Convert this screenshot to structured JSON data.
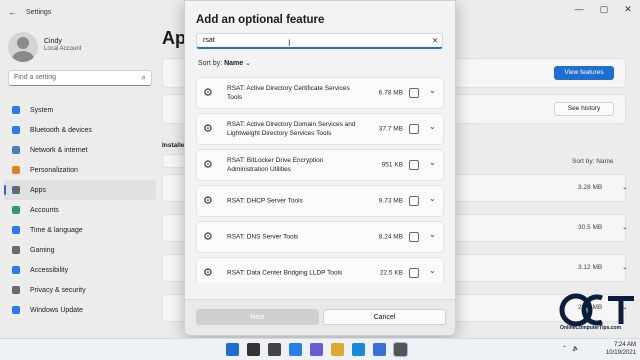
{
  "settings": {
    "title": "Settings",
    "user": {
      "name": "Cindy",
      "account": "Local Account"
    },
    "search_placeholder": "Find a setting",
    "nav": [
      {
        "label": "System",
        "icon": "monitor-icon",
        "color": "#2b7de9"
      },
      {
        "label": "Bluetooth & devices",
        "icon": "bluetooth-icon",
        "color": "#2b7de9"
      },
      {
        "label": "Network & internet",
        "icon": "wifi-icon",
        "color": "#4a7fb5"
      },
      {
        "label": "Personalization",
        "icon": "brush-icon",
        "color": "#d9822b"
      },
      {
        "label": "Apps",
        "icon": "apps-icon",
        "color": "#5b6b7a"
      },
      {
        "label": "Accounts",
        "icon": "person-icon",
        "color": "#2f9b6b"
      },
      {
        "label": "Time & language",
        "icon": "globe-clock-icon",
        "color": "#2b7de9"
      },
      {
        "label": "Gaming",
        "icon": "controller-icon",
        "color": "#6b6b6b"
      },
      {
        "label": "Accessibility",
        "icon": "accessibility-icon",
        "color": "#2b7de9"
      },
      {
        "label": "Privacy & security",
        "icon": "shield-icon",
        "color": "#6b6b6b"
      },
      {
        "label": "Windows Update",
        "icon": "update-icon",
        "color": "#2b7de9"
      }
    ],
    "active_nav": "Apps",
    "page_title": "App",
    "view_features_label": "View features",
    "see_history_label": "See history",
    "installed_label": "Installe",
    "sort_label": "Sort by: Name",
    "installed_sizes": [
      "3.28 MB",
      "30.5 MB",
      "3.12 MB",
      "25.8 MB"
    ]
  },
  "dialog": {
    "title": "Add an optional feature",
    "search_value": "rsat",
    "sort_label": "Sort by:",
    "sort_value": "Name",
    "features": [
      {
        "name": "RSAT: Active Directory Certificate Services Tools",
        "size": "6.78 MB"
      },
      {
        "name": "RSAT: Active Directory Domain Services and Lightweight Directory Services Tools",
        "size": "37.7 MB"
      },
      {
        "name": "RSAT: BitLocker Drive Encryption Administration Utilities",
        "size": "951 KB"
      },
      {
        "name": "RSAT: DHCP Server Tools",
        "size": "9.73 MB"
      },
      {
        "name": "RSAT: DNS Server Tools",
        "size": "8.24 MB"
      },
      {
        "name": "RSAT: Data Center Bridging LLDP Tools",
        "size": "22.5 KB"
      }
    ],
    "next_label": "Next",
    "cancel_label": "Cancel"
  },
  "watermark": {
    "logo_text": "OCT",
    "site": "OnlineComputerTips.com"
  },
  "taskbar": {
    "time": "7:24 AM",
    "date": "10/19/2021",
    "apps": [
      "start-icon",
      "search-icon",
      "task-view-icon",
      "widgets-icon",
      "chat-icon",
      "file-explorer-icon",
      "edge-icon",
      "store-icon",
      "settings-icon"
    ]
  },
  "colors": {
    "accent": "#1f6fd1",
    "dialog_bg": "#f3f3f3",
    "settings_bg": "#ececec"
  }
}
